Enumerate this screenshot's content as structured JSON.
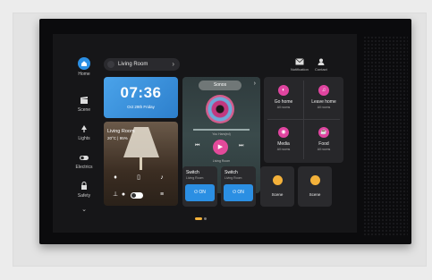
{
  "sidebar": {
    "items": [
      {
        "label": "Home"
      },
      {
        "label": "Scene"
      },
      {
        "label": "Lights"
      },
      {
        "label": "Electrics"
      },
      {
        "label": "Safety"
      }
    ]
  },
  "header": {
    "room": "Living Room",
    "notification": "Notification",
    "contact": "Contact"
  },
  "clock": {
    "time": "07:36",
    "date": "Oct 29th Friday"
  },
  "room_card": {
    "title": "Living Room",
    "sub": "20°C | 95%"
  },
  "music": {
    "source": "Sonos",
    "now_playing": "You Ham(ed)",
    "room": "Living Room",
    "play_icon": "▶",
    "prev_icon": "⏮",
    "next_icon": "⏭"
  },
  "scenes": [
    {
      "name": "Go home",
      "sub": "All rooms"
    },
    {
      "name": "Leave home",
      "sub": "All rooms"
    },
    {
      "name": "Media",
      "sub": "All rooms"
    },
    {
      "name": "Food",
      "sub": "All rooms"
    }
  ],
  "switches": [
    {
      "name": "Switch",
      "room": "Living Room",
      "state": "ON"
    },
    {
      "name": "Switch",
      "room": "Living Room",
      "state": "ON"
    }
  ],
  "scene_buttons": [
    {
      "name": "Scene"
    },
    {
      "name": "Scene"
    }
  ],
  "colors": {
    "accent": "#2b8fe3",
    "pink": "#e24a9a",
    "amber": "#f3b13a"
  }
}
